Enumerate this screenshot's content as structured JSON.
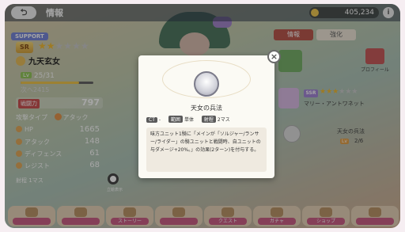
{
  "topbar": {
    "back_label": "⮌",
    "title": "情報",
    "currency_value": "405,234",
    "info_label": "i"
  },
  "character": {
    "support_tag": "SUPPORT",
    "rank": "SR",
    "stars_total": 6,
    "stars_filled": 2,
    "name": "九天玄女",
    "level_label": "Lv",
    "level": "25",
    "level_max": "/31",
    "level_progress": 0.8,
    "exp_text": "次へ2415",
    "power_label": "戦闘力",
    "power_value": "797",
    "type_label": "攻撃タイプ",
    "type_value": "アタック",
    "stats": [
      {
        "label": "HP",
        "value": "1665"
      },
      {
        "label": "アタック",
        "value": "148"
      },
      {
        "label": "ディフェンス",
        "value": "61"
      },
      {
        "label": "レジスト",
        "value": "68"
      }
    ],
    "range_label": "射程",
    "range_value": "1マス"
  },
  "zoom": {
    "label": "立絵表示"
  },
  "right_panel": {
    "tab_info": "情報",
    "tab_enhance": "強化",
    "profile_label": "プロフィール",
    "partner_rank": "SSR",
    "partner_stars_filled": 3,
    "partner_stars_total": 6,
    "partner_name": "マリー・アントワネット",
    "support_skill_name": "天女の兵法",
    "support_skill_lv_label": "Lv",
    "support_skill_lv": "2/6"
  },
  "bottom_nav": [
    "",
    "",
    "ストーリー",
    "",
    "クエスト",
    "ガチャ",
    "ショップ",
    ""
  ],
  "modal": {
    "skill_name": "天女の兵法",
    "params": [
      {
        "tag": "CT",
        "value": "-"
      },
      {
        "tag": "範囲",
        "value": "単体"
      },
      {
        "tag": "射程",
        "value": "2マス"
      }
    ],
    "description": "味方ユニット1騎に「メインが「ソルジャー/ランサー/ライダー」の騎ユニットと戦闘時、自ユニットの与ダメージ+20%。」の効果(2ターン)を付与する。",
    "close_label": "×"
  },
  "colors": {
    "accent_red": "#b5473c",
    "star_gold": "#f3b61f",
    "support_blue": "#6a7ad8"
  }
}
